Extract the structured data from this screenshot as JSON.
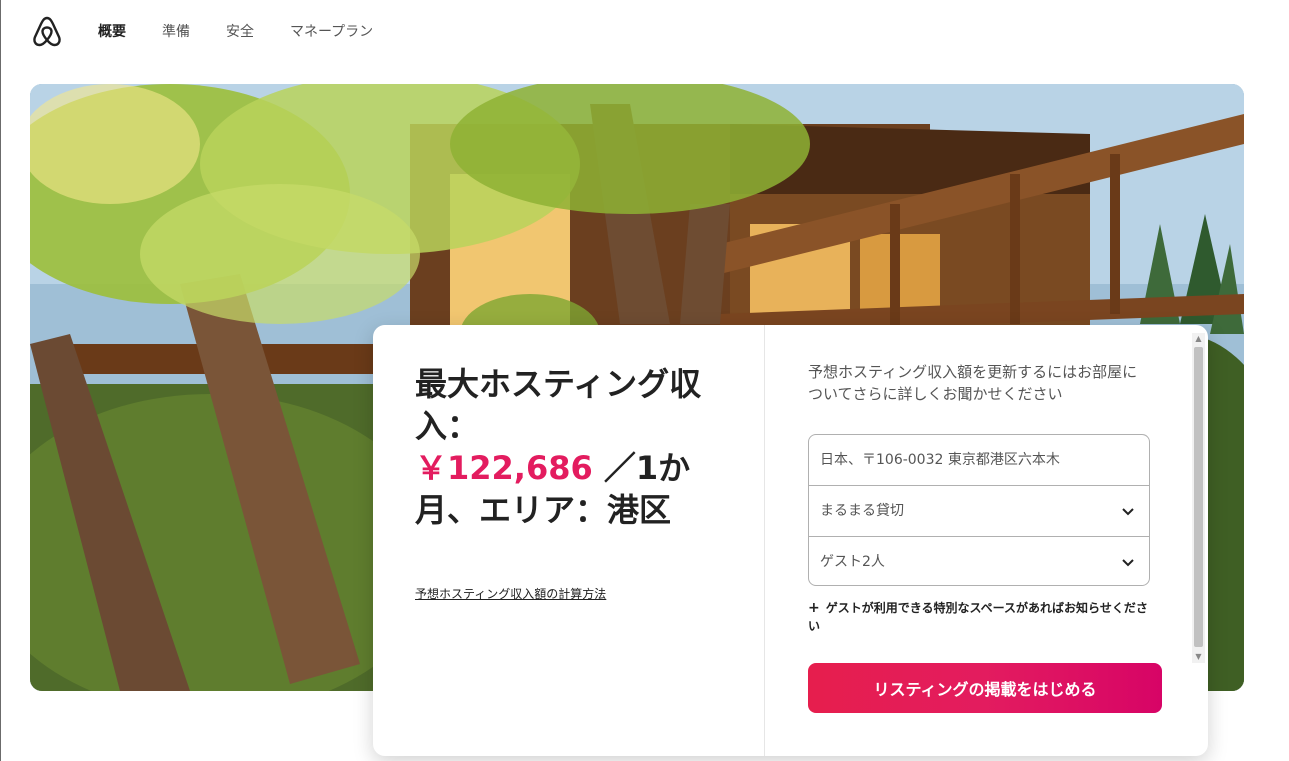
{
  "header": {
    "logo": "airbnb-logo-icon",
    "tabs": [
      {
        "label": "概要",
        "active": true
      },
      {
        "label": "準備",
        "active": false
      },
      {
        "label": "安全",
        "active": false
      },
      {
        "label": "マネープラン",
        "active": false
      }
    ]
  },
  "card": {
    "headline_prefix": "最大ホスティング収入：",
    "amount": "￥122,686",
    "headline_suffix": "／1か月、エリア：港区",
    "calc_link": "予想ホスティング収入額の計算方法",
    "intro": "予想ホスティング収入額を更新するにはお部屋についてさらに詳しくお聞かせください",
    "address": "日本、〒106-0032 東京都港区六本木",
    "room_type": "まるまる貸切",
    "guests": "ゲスト2人",
    "add_space": "ゲストが利用できる特別なスペースがあればお知らせください",
    "cta": "リスティングの掲載をはじめる"
  },
  "colors": {
    "brand": "#e31c5f",
    "text": "#222222",
    "muted": "#555555"
  }
}
